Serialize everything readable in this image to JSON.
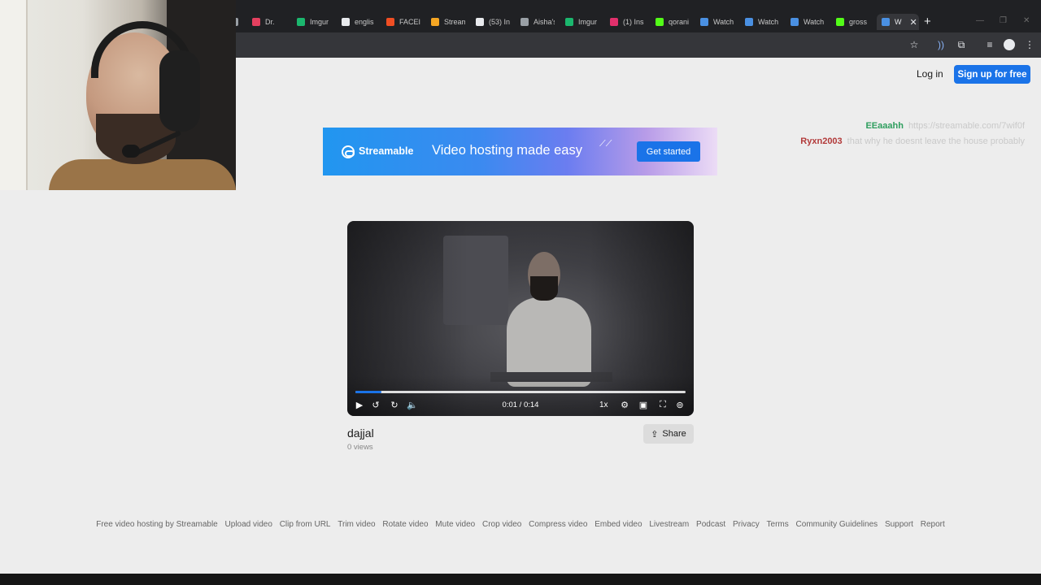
{
  "browser": {
    "tabs": [
      {
        "label": "...",
        "color": "#9aa0a6"
      },
      {
        "label": "Dr.",
        "color": "#e4405f"
      },
      {
        "label": "Imgur",
        "color": "#1bb76e"
      },
      {
        "label": "englis",
        "color": "#e8eaed"
      },
      {
        "label": "FACEI",
        "color": "#f04e23"
      },
      {
        "label": "Stream",
        "color": "#f5a623"
      },
      {
        "label": "(53) In",
        "color": "#e8eaed"
      },
      {
        "label": "Aisha's",
        "color": "#9aa0a6"
      },
      {
        "label": "Imgur",
        "color": "#1bb76e"
      },
      {
        "label": "(1) Ins",
        "color": "#e1306c"
      },
      {
        "label": "qorani",
        "color": "#53fc18"
      },
      {
        "label": "Watch",
        "color": "#4a90e2"
      },
      {
        "label": "Watch",
        "color": "#4a90e2"
      },
      {
        "label": "Watch",
        "color": "#4a90e2"
      },
      {
        "label": "gross",
        "color": "#53fc18"
      },
      {
        "label": "W",
        "color": "#4a90e2"
      }
    ]
  },
  "header": {
    "login_label": "Log in",
    "signup_label": "Sign up for free"
  },
  "banner": {
    "brand": "Streamable",
    "tagline": "Video hosting made easy",
    "cta": "Get started"
  },
  "chat": [
    {
      "user": "EEaaahh",
      "user_color": "#2e9e5e",
      "message": "https://streamable.com/7wif0f"
    },
    {
      "user": "Ryxn2003",
      "user_color": "#b23a3a",
      "message": "that why he doesnt leave the house probably"
    }
  ],
  "player": {
    "time": "0:01 / 0:14",
    "progress": 0.08,
    "speed": "1x"
  },
  "video": {
    "title": "dajjal",
    "views": "0 views",
    "share_label": "Share"
  },
  "footer": {
    "links": [
      "Free video hosting by Streamable",
      "Upload video",
      "Clip from URL",
      "Trim video",
      "Rotate video",
      "Mute video",
      "Crop video",
      "Compress video",
      "Embed video",
      "Livestream",
      "Podcast",
      "Privacy",
      "Terms",
      "Community Guidelines",
      "Support",
      "Report"
    ]
  },
  "colors": {
    "accent": "#1a73e8",
    "page_bg": "#ededed"
  }
}
